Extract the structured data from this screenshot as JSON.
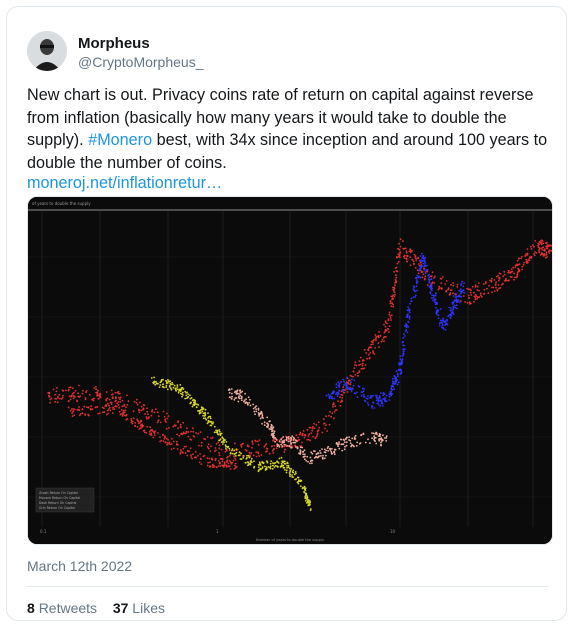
{
  "tweet": {
    "author_name": "Morpheus",
    "author_handle": "@CryptoMorpheus_",
    "text_before": "New chart is out. Privacy coins rate of return on capital against reverse from inflation (basically how many years it would take to double the supply). ",
    "hashtag": "#Monero",
    "text_after": " best, with 34x since inception and around 100 years to double the number of coins.",
    "link": "moneroj.net/inflationretur…",
    "date": "March 12th 2022",
    "retweets_count": "8",
    "retweets_label": "Retweets",
    "likes_count": "37",
    "likes_label": "Likes"
  },
  "media": {
    "header_label": "of years to double the supply",
    "xlabel": "Number of years to double the supply",
    "x_tick_labels": [
      "0.1",
      "1",
      "10"
    ],
    "legend": [
      "Zcash Return On Capital",
      "Monero Return On Capital",
      "Dash Return On Capital",
      "Grin Return On Capital"
    ],
    "colors": {
      "background": "#0b0b0b",
      "grid": "#2a2a2a",
      "red": "#e23030",
      "blue": "#2f34ff",
      "yellow": "#d7d62a",
      "pink": "#f2b1a0"
    }
  }
}
